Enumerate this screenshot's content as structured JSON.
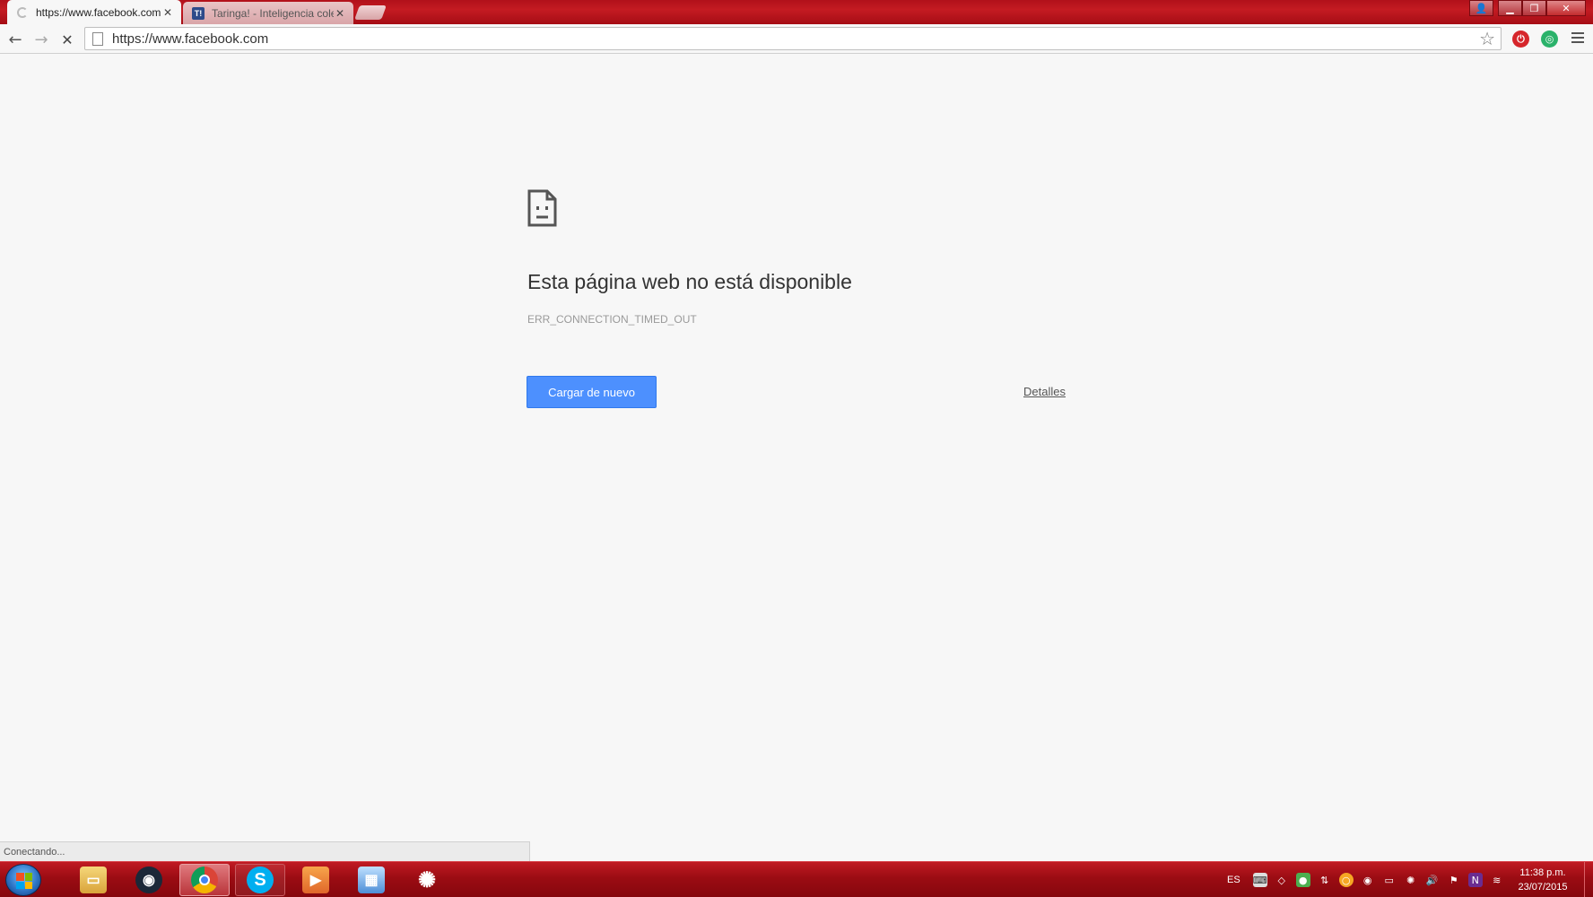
{
  "browser": {
    "tabs": [
      {
        "title": "https://www.facebook.com",
        "state": "loading"
      },
      {
        "title": "Taringa! - Inteligencia colectiva",
        "favicon_text": "T!"
      }
    ],
    "address_bar": {
      "url": "https://www.facebook.com"
    },
    "status_text": "Conectando..."
  },
  "error_page": {
    "headline": "Esta página web no está disponible",
    "error_code": "ERR_CONNECTION_TIMED_OUT",
    "reload_label": "Cargar de nuevo",
    "details_label": "Detalles"
  },
  "taskbar": {
    "apps": [
      "windows-explorer",
      "steam",
      "chrome",
      "skype",
      "media-player",
      "control-panel",
      "steelseries"
    ],
    "language": "ES",
    "clock": {
      "time": "11:38 p.m.",
      "date": "23/07/2015"
    }
  },
  "colors": {
    "theme_red": "#b1101a",
    "button_blue": "#4d90fe",
    "page_bg": "#f7f7f7"
  }
}
